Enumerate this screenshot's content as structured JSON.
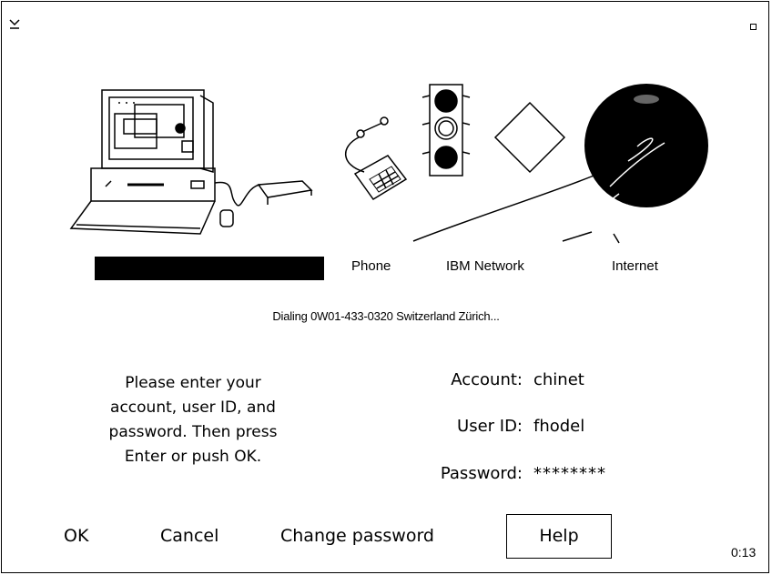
{
  "icons": {
    "system_menu": "system-menu-icon",
    "maximize": "maximize-icon",
    "computer": "computer-icon",
    "phone": "phone-icon",
    "network": "traffic-light-icon",
    "internet": "globe-icon"
  },
  "diagram": {
    "phone_label": "Phone",
    "network_label": "IBM Network",
    "internet_label": "Internet"
  },
  "progress": {
    "fraction": 1.0
  },
  "status_text": "Dialing 0W01-433-0320  Switzerland Zürich...",
  "instructions": {
    "line1": "Please enter your",
    "line2": "account, user ID, and",
    "line3": "password.  Then press",
    "line4": "Enter or push OK."
  },
  "fields": {
    "account_label": "Account:",
    "account_value": "chinet",
    "userid_label": "User ID:",
    "userid_value": "fhodel",
    "password_label": "Password:",
    "password_value": "********"
  },
  "buttons": {
    "ok": "OK",
    "cancel": "Cancel",
    "change_password": "Change password",
    "help": "Help"
  },
  "timer": "0:13"
}
